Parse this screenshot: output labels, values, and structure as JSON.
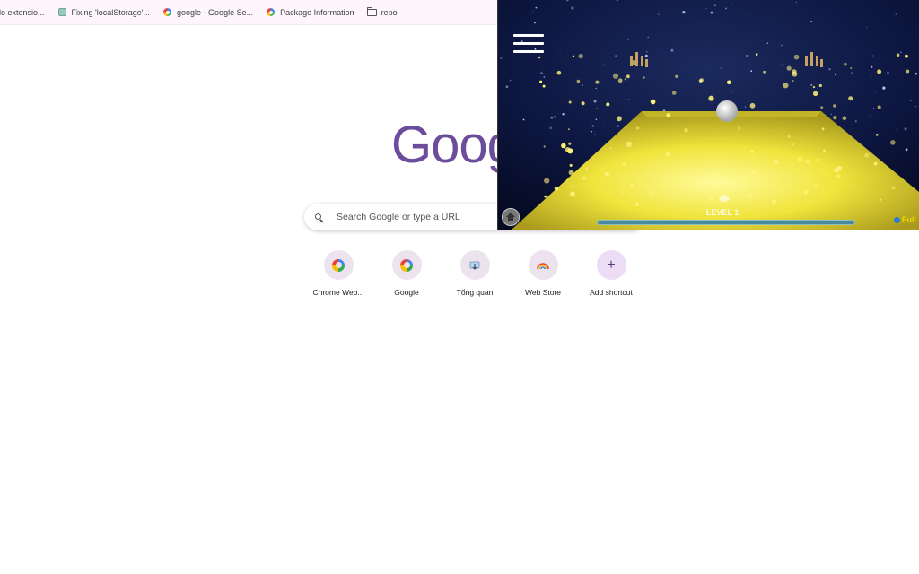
{
  "bookmarks": [
    {
      "label": "do extensio...",
      "icon": "none"
    },
    {
      "label": "Fixing 'localStorage'...",
      "icon": "page-icon"
    },
    {
      "label": "google - Google Se...",
      "icon": "google-icon"
    },
    {
      "label": "Package Information",
      "icon": "google-icon"
    },
    {
      "label": "repo",
      "icon": "folder-icon"
    }
  ],
  "logo": {
    "text": "Goog"
  },
  "search": {
    "placeholder": "Search Google or type a URL"
  },
  "shortcuts": [
    {
      "label": "Chrome Web...",
      "icon": "google-icon"
    },
    {
      "label": "Google",
      "icon": "google-icon"
    },
    {
      "label": "Tổng quan",
      "icon": "download-icon"
    },
    {
      "label": "Web Store",
      "icon": "rainbow-icon"
    },
    {
      "label": "Add shortcut",
      "icon": "plus-icon"
    }
  ],
  "game": {
    "level_label": "LEVEL 1",
    "fullscreen_label": "Full",
    "progress": 1.0,
    "colors": {
      "sky": "#0a1030",
      "floor": "#e8df3a",
      "accent": "#f2d400"
    }
  }
}
